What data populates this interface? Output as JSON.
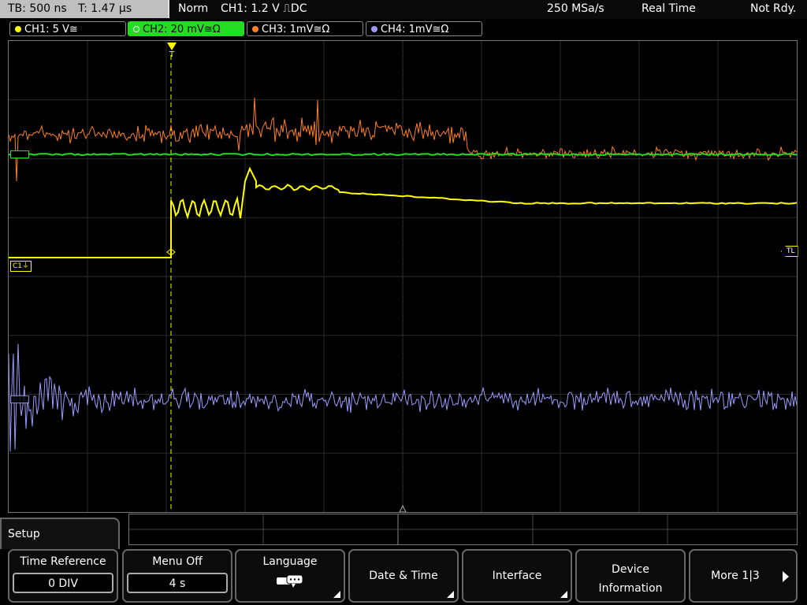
{
  "topbar": {
    "timebase": "TB: 500 ns",
    "trigger_time": "T: 1.47 µs",
    "mode": "Norm",
    "trigger_info": "CH1: 1.2 V ⎍DC",
    "sample_rate": "250 MSa/s",
    "acquisition": "Real Time",
    "status": "Not Rdy."
  },
  "channels": [
    {
      "label": "CH1: 5 V≅",
      "color": "#ffff00",
      "active": false
    },
    {
      "label": "CH2: 20 mV≅Ω",
      "color": "#22dd22",
      "active": true
    },
    {
      "label": "CH3: 1mV≅Ω",
      "color": "#ff7f27",
      "active": false
    },
    {
      "label": "CH4: 1mV≅Ω",
      "color": "#9b9bff",
      "active": false
    }
  ],
  "markers": {
    "trigger_level": "TL",
    "ch1_marker": "C1⏚",
    "trigger_pos": "T"
  },
  "menu": {
    "title": "Setup",
    "softkeys": [
      {
        "label": "Time Reference",
        "value": "0 DIV"
      },
      {
        "label": "Menu Off",
        "value": "4 s"
      },
      {
        "label": "Language",
        "icon": "speech-bubble-icon"
      },
      {
        "label": "Date & Time"
      },
      {
        "label": "Interface"
      },
      {
        "label": "Device Information"
      },
      {
        "label": "More 1|3"
      }
    ]
  }
}
